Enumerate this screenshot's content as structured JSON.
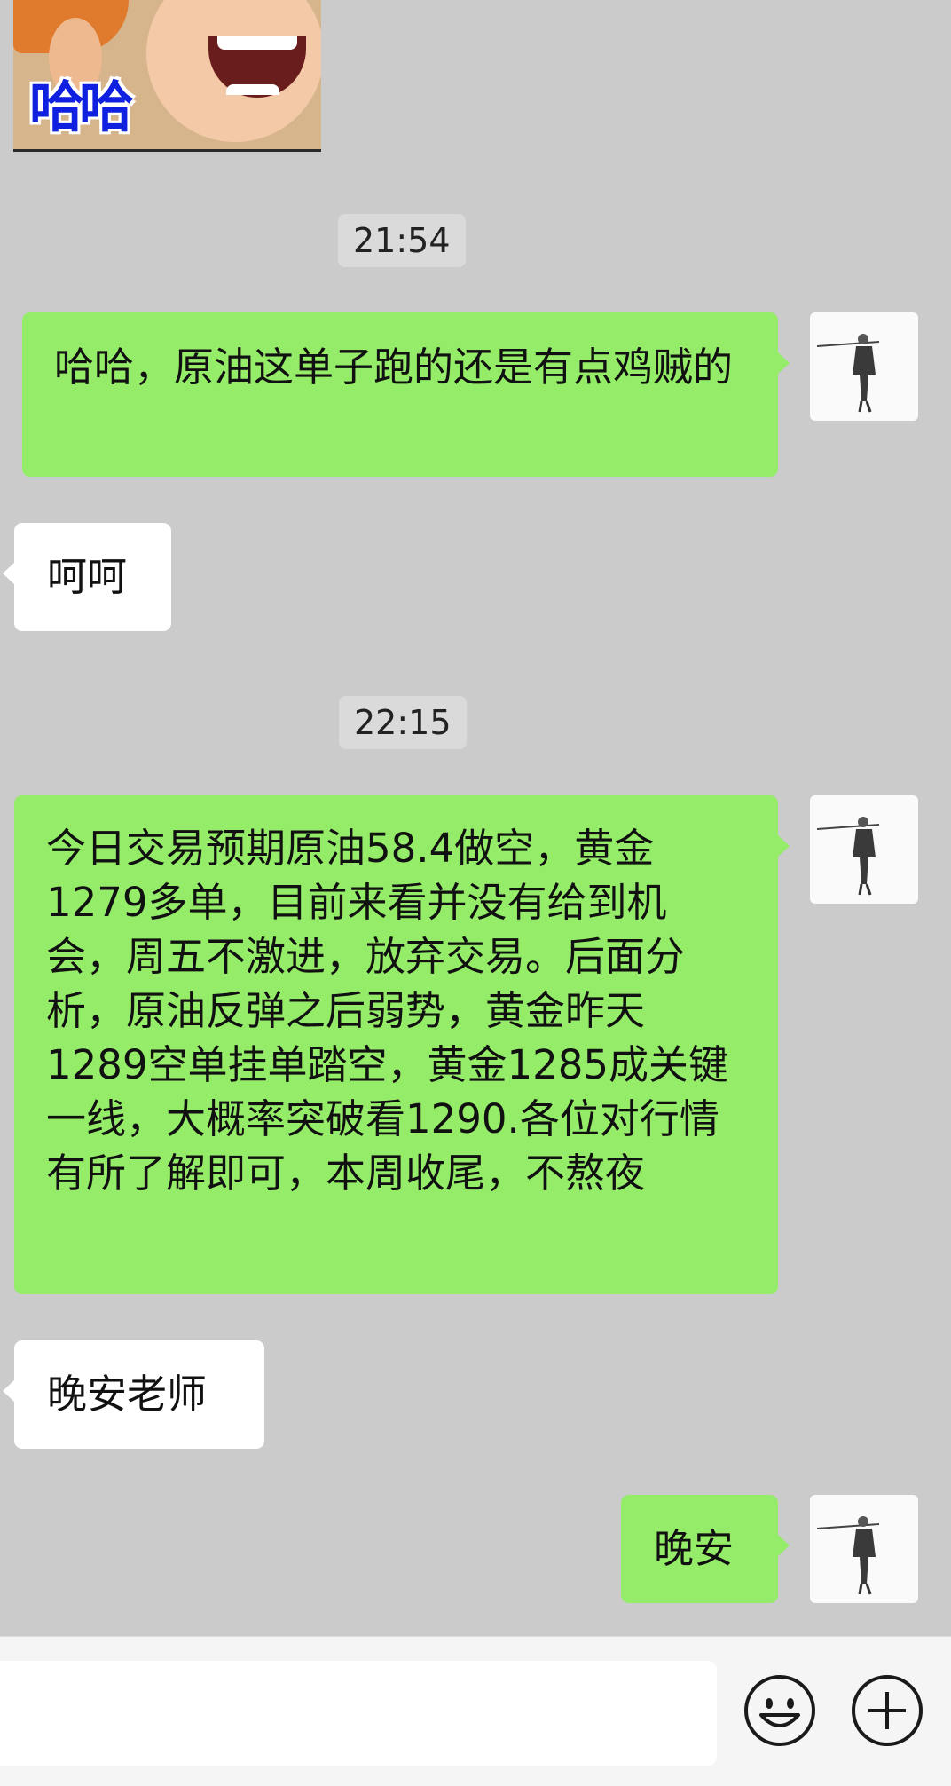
{
  "chat": {
    "sticker": {
      "caption": "哈哈"
    },
    "messages": [
      {
        "type": "time",
        "text": "21:54"
      },
      {
        "type": "sent",
        "text": "哈哈，原油这单子跑的还是有点鸡贼的"
      },
      {
        "type": "received",
        "text": "呵呵"
      },
      {
        "type": "time",
        "text": "22:15"
      },
      {
        "type": "sent",
        "text": "今日交易预期原油58.4做空，黄金1279多单，目前来看并没有给到机会，周五不激进，放弃交易。后面分析，原油反弹之后弱势，黄金昨天1289空单挂单踏空，黄金1285成关键一线，大概率突破看1290.各位对行情有所了解即可，本周收尾，不熬夜"
      },
      {
        "type": "received",
        "text": "晚安老师"
      },
      {
        "type": "sent",
        "text": "晚安"
      }
    ]
  },
  "input_bar": {
    "text_value": "",
    "emoji_icon": "smiley-face-icon",
    "add_icon": "plus-circle-icon"
  },
  "colors": {
    "chat_background": "#cbcbcb",
    "sent_bubble": "#95ec69",
    "received_bubble": "#ffffff",
    "input_bar": "#f5f5f5"
  }
}
